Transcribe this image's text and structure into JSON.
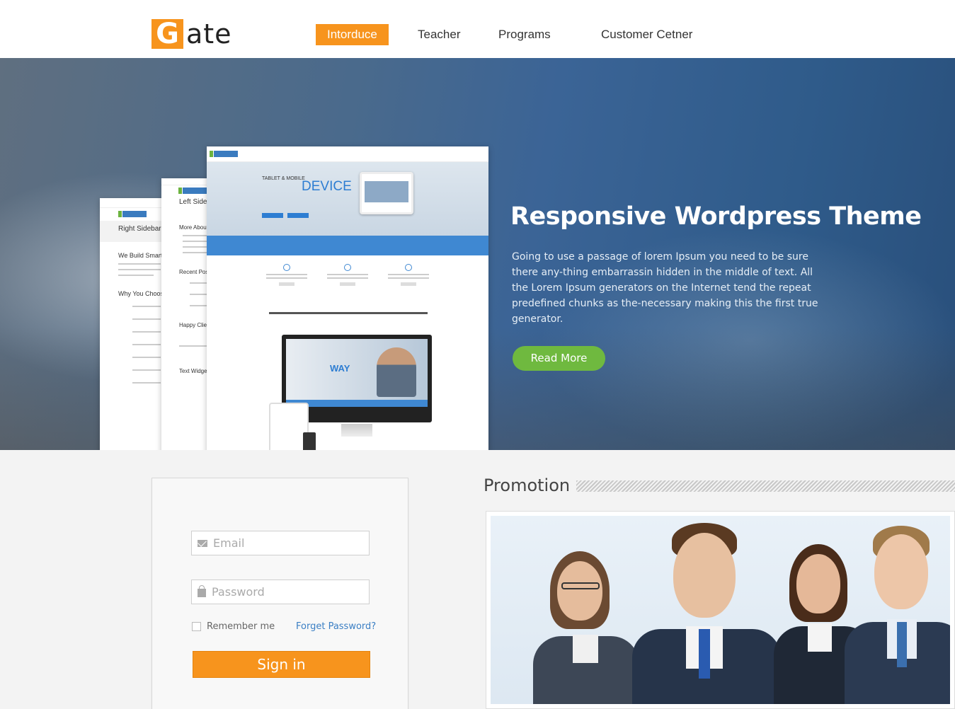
{
  "brand": {
    "logo_letter": "G",
    "logo_text": "ate",
    "accent": "#f7941d"
  },
  "nav": {
    "items": [
      {
        "label": "Intorduce",
        "active": true
      },
      {
        "label": "Teacher",
        "active": false
      },
      {
        "label": "Programs",
        "active": false
      },
      {
        "label": "Customer Cetner",
        "active": false
      }
    ]
  },
  "hero": {
    "title": "Responsive Wordpress Theme",
    "description": "Going to use a passage of lorem Ipsum you need to be sure there any-thing embarrassin hidden in the middle of text. All the Lorem Ipsum generators on the Internet tend the repeat predefined chunks as the-necessary making this the first true generator.",
    "button": "Read More",
    "button_color": "#6fb93f",
    "mockup": {
      "device_word": "DEVICE",
      "way_word": "WAY",
      "sidebar_right": "Right Sidebar",
      "sidebar_left": "Left Sideb",
      "we_build": "We Build Smarter",
      "why_choose": "Why You Choose",
      "more_about": "More About U",
      "recent_posts": "Recent Posts",
      "happy_client": "Happy Client",
      "text_widget": "Text Widget"
    }
  },
  "login": {
    "email_placeholder": "Email",
    "password_placeholder": "Password",
    "remember_label": "Remember me",
    "forgot_label": "Forget Password?",
    "signin_label": "Sign in"
  },
  "promotion": {
    "title": "Promotion"
  }
}
